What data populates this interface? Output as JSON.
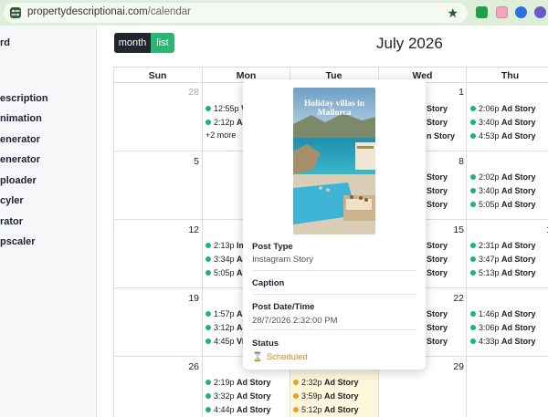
{
  "browser": {
    "url_host": "propertydescriptionai.com",
    "url_path": "/calendar"
  },
  "sidebar": {
    "items": [
      "rd",
      "escription",
      "nimation",
      "enerator",
      "enerator",
      "ploader",
      "cyler",
      "rator",
      "pscaler"
    ]
  },
  "toolbar": {
    "month_label": "month",
    "list_label": "list",
    "title": "July 2026"
  },
  "calendar": {
    "days_of_week": [
      "Sun",
      "Mon",
      "Tue",
      "Wed",
      "Thu"
    ],
    "day_numbers": {
      "r1": [
        "28",
        "1"
      ],
      "r2": [
        "5",
        "8"
      ],
      "r3": [
        "12",
        "15",
        "1"
      ],
      "r4": [
        "19",
        "22"
      ],
      "r5": [
        "26",
        "29"
      ]
    },
    "events": {
      "mon_r1": [
        {
          "time": "12:55p",
          "title": "Vi"
        },
        {
          "time": "2:12p",
          "title": "Ad"
        }
      ],
      "mon_r1_more": "+2 more",
      "wed_r1": [
        {
          "title": "Story"
        },
        {
          "title": "Story"
        },
        {
          "title": "n Story"
        }
      ],
      "thu_r1": [
        {
          "time": "2:06p",
          "title": "Ad Story"
        },
        {
          "time": "3:40p",
          "title": "Ad Story"
        },
        {
          "time": "4:53p",
          "title": "Ad Story"
        }
      ],
      "wed_r2": [
        {
          "title": "Story"
        },
        {
          "title": "Story"
        },
        {
          "title": "Story"
        }
      ],
      "thu_r2": [
        {
          "time": "2:02p",
          "title": "Ad Story"
        },
        {
          "time": "3:40p",
          "title": "Ad Story"
        },
        {
          "time": "5:05p",
          "title": "Ad Story"
        }
      ],
      "mon_r3": [
        {
          "time": "2:13p",
          "title": "Ima"
        },
        {
          "time": "3:34p",
          "title": "Ad"
        },
        {
          "time": "5:05p",
          "title": "Ad"
        }
      ],
      "wed_r3": [
        {
          "title": "Story"
        },
        {
          "title": "Story"
        },
        {
          "title": "Story"
        }
      ],
      "thu_r3": [
        {
          "time": "2:31p",
          "title": "Ad Story"
        },
        {
          "time": "3:47p",
          "title": "Ad Story"
        },
        {
          "time": "5:13p",
          "title": "Ad Story"
        }
      ],
      "mon_r4": [
        {
          "time": "1:57p",
          "title": "Ad"
        },
        {
          "time": "3:12p",
          "title": "Ad"
        },
        {
          "time": "4:45p",
          "title": "Vid"
        }
      ],
      "wed_r4": [
        {
          "title": "Story"
        },
        {
          "title": "Story"
        },
        {
          "title": "Story"
        }
      ],
      "thu_r4": [
        {
          "time": "1:46p",
          "title": "Ad Story"
        },
        {
          "time": "3:06p",
          "title": "Ad Story"
        },
        {
          "time": "4:33p",
          "title": "Ad Story"
        }
      ],
      "mon_r5": [
        {
          "time": "2:19p",
          "title": "Ad Story"
        },
        {
          "time": "3:32p",
          "title": "Ad Story"
        },
        {
          "time": "4:44p",
          "title": "Ad Story"
        }
      ],
      "tue_r5": [
        {
          "time": "2:32p",
          "title": "Ad Story"
        },
        {
          "time": "3:59p",
          "title": "Ad Story"
        },
        {
          "time": "5:12p",
          "title": "Ad Story"
        }
      ]
    }
  },
  "popover": {
    "image_caption": "Holiday villas in Mallorca",
    "post_type_label": "Post Type",
    "post_type_value": "Instagram Story",
    "caption_label": "Caption",
    "date_label": "Post Date/Time",
    "date_value": "28/7/2026 2:32:00 PM",
    "status_label": "Status",
    "status_value": "Scheduled"
  },
  "colors": {
    "accent_green": "#2bb573",
    "event_dot": "#20b07a",
    "scheduled_orange": "#e8a21c",
    "today_highlight": "#fdf6dc"
  }
}
